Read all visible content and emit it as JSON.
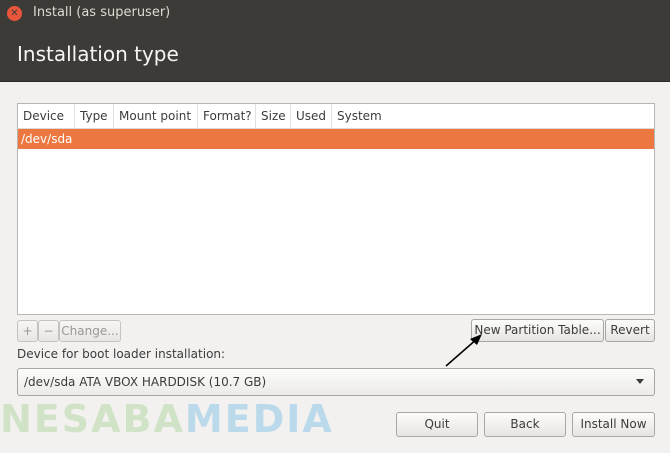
{
  "window": {
    "title": "Install (as superuser)"
  },
  "page": {
    "title": "Installation type"
  },
  "table": {
    "columns": [
      "Device",
      "Type",
      "Mount point",
      "Format?",
      "Size",
      "Used",
      "System"
    ],
    "rows": [
      {
        "device": "/dev/sda"
      }
    ]
  },
  "toolbar": {
    "add_label": "+",
    "remove_label": "−",
    "change_label": "Change..."
  },
  "actions": {
    "new_partition_table_label": "New Partition Table...",
    "revert_label": "Revert"
  },
  "bootloader": {
    "label": "Device for boot loader installation:",
    "selected": "/dev/sda ATA VBOX HARDDISK (10.7 GB)"
  },
  "footer": {
    "quit_label": "Quit",
    "back_label": "Back",
    "install_now_label": "Install Now"
  },
  "watermark": {
    "part1": "NESABA",
    "part2": "MEDIA"
  },
  "colors": {
    "selection": "#ed7740",
    "titlebar": "#3c3b37",
    "close": "#e9563b"
  }
}
